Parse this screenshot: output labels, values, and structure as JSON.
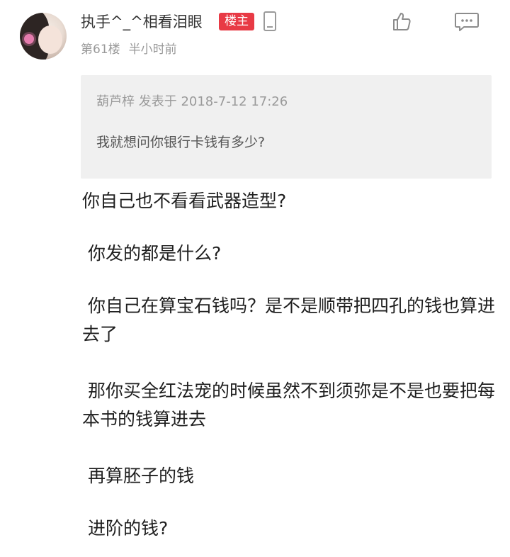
{
  "post": {
    "username": "执手^_^相看泪眼",
    "badge": "楼主",
    "floor": "第61楼",
    "time": "半小时前",
    "quote": {
      "header": "葫芦梓 发表于 2018-7-12 17:26",
      "text": "我就想问你银行卡钱有多少?"
    },
    "paragraphs": [
      "你自己也不看看武器造型?",
      " 你发的都是什么?",
      " 你自己在算宝石钱吗？是不是顺带把四孔的钱也算进去了",
      " 那你买全红法宠的时候虽然不到须弥是不是也要把每本书的钱算进去",
      " 再算胚子的钱",
      " 进阶的钱?"
    ]
  },
  "icons": {
    "phone": "phone-icon",
    "like": "thumbs-up-icon",
    "comment": "comment-icon"
  },
  "colors": {
    "badge_bg": "#e83a45",
    "quote_bg": "#f0f0f0",
    "meta_text": "#999999"
  }
}
